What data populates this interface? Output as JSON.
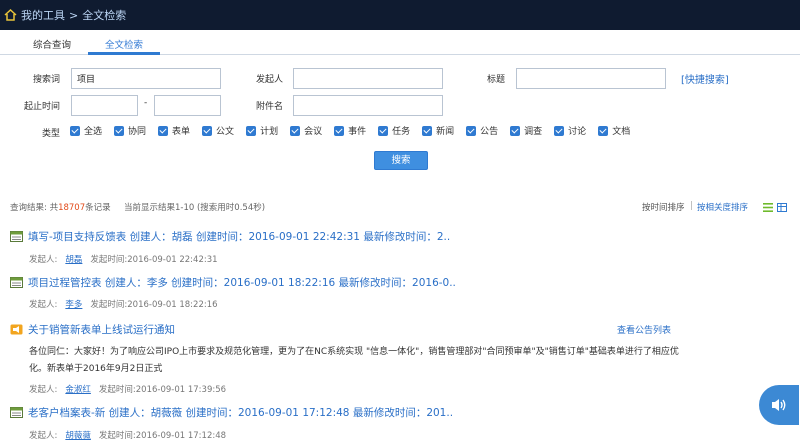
{
  "header": {
    "crumb_home": "我的工具",
    "crumb_sep": ">",
    "crumb_current": "全文检索"
  },
  "tabs": [
    {
      "label": "综合查询"
    },
    {
      "label": "全文检索"
    }
  ],
  "form": {
    "keyword_label": "搜索词",
    "keyword_value": "项目",
    "initiator_label": "发起人",
    "initiator_value": "",
    "title_label": "标题",
    "title_value": "",
    "quick_search": "[快捷搜索]",
    "date_label": "起止时间",
    "date_from": "",
    "date_sep": "-",
    "date_to": "",
    "attach_label": "附件名",
    "attach_value": "",
    "type_label": "类型",
    "types": [
      "全选",
      "协同",
      "表单",
      "公文",
      "计划",
      "会议",
      "事件",
      "任务",
      "新闻",
      "公告",
      "调查",
      "讨论",
      "文档"
    ],
    "search_button": "搜索"
  },
  "summary": {
    "prefix": "查询结果: 共",
    "total": "18707",
    "suffix": "条记录",
    "current": "当前显示结果1-10 (搜索用时0.54秒)",
    "sort_time": "按时间排序",
    "sort_sep": "|",
    "sort_relevance": "按相关度排序"
  },
  "results": [
    {
      "title": "填写-项目支持反馈表 创建人：胡磊 创建时间：2016-09-01 22:42:31 最新修改时间：2..",
      "meta_label": "发起人:",
      "initiator": "胡磊",
      "meta_time": "发起时间:2016-09-01 22:42:31"
    },
    {
      "title": "项目过程管控表 创建人：李多 创建时间：2016-09-01 18:22:16 最新修改时间：2016-0..",
      "meta_label": "发起人:",
      "initiator": "李多",
      "meta_time": "发起时间:2016-09-01 18:22:16"
    },
    {
      "title": "关于销管新表单上线试运行通知",
      "link": "查看公告列表",
      "body1": "各位同仁：大家好！为了响应公司IPO上市要求及规范化管理，更为了在NC系统实现 \"信息一体化\"，销售管理部对\"合同预审单\"及\"销售订单\"基础表单进行了相应优",
      "body2": "化。新表单于2016年9月2日正式",
      "meta_label": "发起人:",
      "initiator": "金淑红",
      "meta_time": "发起时间:2016-09-01 17:39:56"
    },
    {
      "title": "老客户档案表-新 创建人：胡薇薇 创建时间：2016-09-01 17:12:48 最新修改时间：201..",
      "meta_label": "发起人:",
      "initiator": "胡薇薇",
      "meta_time": "发起时间:2016-09-01 17:12:48"
    }
  ],
  "colors": {
    "topbar": "#0f1b30",
    "accent": "#2f7ad1",
    "link": "#2a6fc7",
    "count": "#e24b1a"
  }
}
